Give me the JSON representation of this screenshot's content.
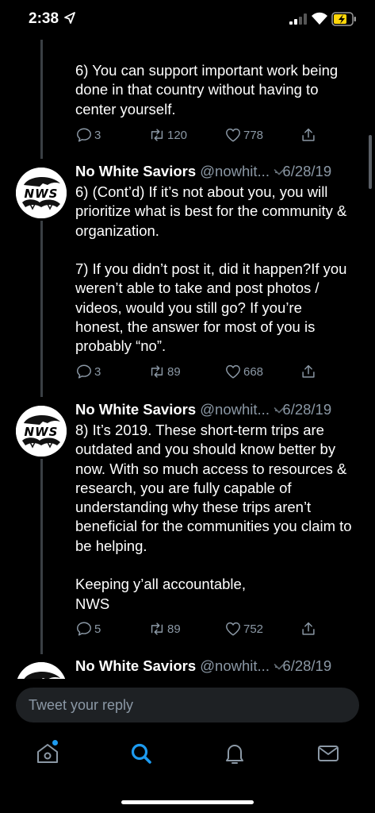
{
  "status_bar": {
    "time": "2:38",
    "icons": [
      "location-arrow-icon",
      "cellular-signal-icon",
      "wifi-icon",
      "battery-charging-icon"
    ]
  },
  "tweets": [
    {
      "body": "6) You can support important work being done in that country without having to center yourself.",
      "replies": "3",
      "retweets": "120",
      "likes": "778"
    },
    {
      "author_name": "No White Saviors",
      "handle": "@nowhit...",
      "date": "· 6/28/19",
      "avatar_text": "NWS",
      "body": "6) (Cont’d) If it’s not about you, you will prioritize what is best for the community & organization.\n\n7) If you didn’t post it, did it happen?If you weren’t able to take and post photos / videos, would you still go? If you’re honest, the answer for most of you is probably “no”.",
      "replies": "3",
      "retweets": "89",
      "likes": "668"
    },
    {
      "author_name": "No White Saviors",
      "handle": "@nowhit...",
      "date": "· 6/28/19",
      "avatar_text": "NWS",
      "body": "8) It’s 2019. These short-term trips are outdated and you should know better by now. With so much access to resources & research, you are fully capable of understanding why these trips aren’t beneficial for the communities you claim to be helping.\n\nKeeping y’all accountable,\nNWS",
      "replies": "5",
      "retweets": "89",
      "likes": "752"
    },
    {
      "author_name": "No White Saviors",
      "handle": "@nowhit...",
      "date": "· 6/28/19"
    }
  ],
  "reply_bar": {
    "placeholder": "Tweet your reply"
  },
  "tab_bar": {
    "tabs": [
      "home-icon",
      "search-icon",
      "notifications-icon",
      "messages-icon"
    ],
    "active": "search-icon"
  },
  "colors": {
    "background": "#000000",
    "muted_text": "#8b98a5",
    "accent": "#1d9bf0",
    "thread_line": "#3a3f44",
    "reply_bar_bg": "#1e2124"
  }
}
